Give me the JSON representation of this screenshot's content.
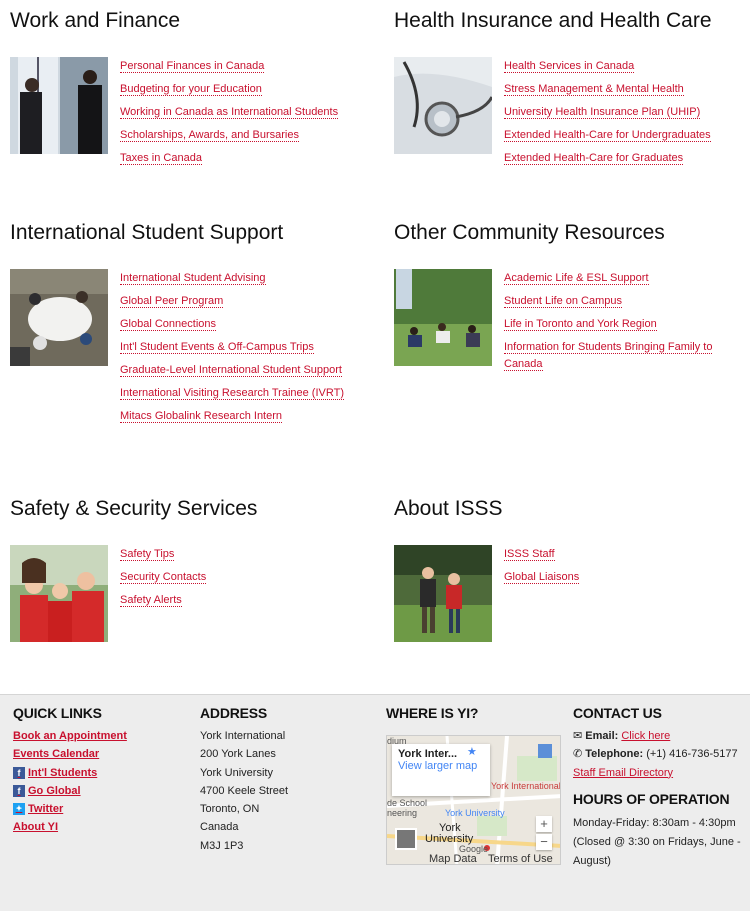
{
  "sections": [
    {
      "title": "Work and Finance",
      "links": [
        "Personal Finances in Canada",
        "Budgeting for your Education",
        "Working in Canada as International Students",
        "Scholarships, Awards, and Bursaries",
        "Taxes in Canada"
      ]
    },
    {
      "title": "Health Insurance and Health Care",
      "links": [
        "Health Services in Canada",
        "Stress Management & Mental Health",
        "University Health Insurance Plan (UHIP)",
        "Extended Health-Care for Undergraduates",
        "Extended Health-Care for Graduates"
      ]
    },
    {
      "title": "International Student Support",
      "links": [
        "International Student Advising",
        "Global Peer Program",
        "Global Connections",
        "Int'l Student Events & Off-Campus Trips",
        "Graduate-Level International Student Support",
        "International Visiting Research Trainee (IVRT)",
        "Mitacs Globalink Research Intern"
      ]
    },
    {
      "title": "Other Community Resources",
      "links": [
        "Academic Life & ESL Support",
        "Student Life on Campus",
        "Life in Toronto and York Region",
        "Information for Students Bringing Family to Canada"
      ]
    },
    {
      "title": "Safety & Security Services",
      "links": [
        "Safety Tips",
        "Security Contacts",
        "Safety Alerts"
      ]
    },
    {
      "title": "About ISSS",
      "links": [
        "ISSS Staff",
        "Global Liaisons"
      ]
    }
  ],
  "footer": {
    "quick_links": {
      "heading": "QUICK LINKS",
      "items": [
        "Book an Appointment",
        "Events Calendar",
        "Int'l Students",
        "Go Global",
        "Twitter",
        "About YI"
      ]
    },
    "address": {
      "heading": "ADDRESS",
      "lines": [
        "York International",
        "200 York Lanes",
        "York University",
        "4700 Keele Street",
        "Toronto, ON",
        "Canada",
        "M3J 1P3"
      ]
    },
    "where": {
      "heading": "WHERE IS YI?",
      "card_title": "York Inter...",
      "card_link": "View larger map",
      "labels": [
        "York International",
        "de School",
        "neering",
        "York University",
        "York",
        "University",
        "Google",
        "Map Data",
        "Terms of Use",
        "dium"
      ]
    },
    "contact": {
      "heading": "CONTACT US",
      "email_label": "Email:",
      "email_link": "Click here",
      "phone_label": "Telephone:",
      "phone_value": "(+1) 416-736-5177",
      "staff_link": "Staff Email Directory"
    },
    "hours": {
      "heading": "HOURS OF OPERATION",
      "lines": [
        "Monday-Friday: 8:30am - 4:30pm",
        "(Closed @ 3:30 on Fridays, June - August)"
      ]
    }
  },
  "colors": {
    "link": "#c8102e",
    "footer_bg": "#ededed"
  }
}
